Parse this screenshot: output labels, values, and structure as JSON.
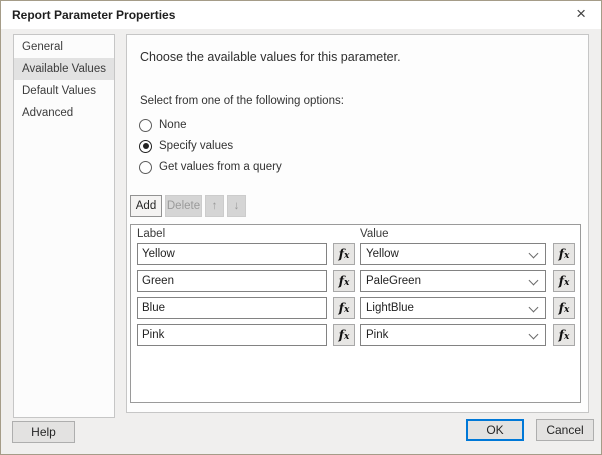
{
  "window": {
    "title": "Report Parameter Properties"
  },
  "icons": {
    "close": "×",
    "arrow_up": "↑",
    "arrow_down": "↓",
    "fx_f": "f",
    "fx_x": "x"
  },
  "sidebar": {
    "items": [
      {
        "label": "General",
        "selected": false
      },
      {
        "label": "Available Values",
        "selected": true
      },
      {
        "label": "Default Values",
        "selected": false
      },
      {
        "label": "Advanced",
        "selected": false
      }
    ]
  },
  "main": {
    "heading": "Choose the available values for this parameter.",
    "options_label": "Select from one of the following options:",
    "radio_options": [
      {
        "label": "None",
        "selected": false
      },
      {
        "label": "Specify values",
        "selected": true
      },
      {
        "label": "Get values from a query",
        "selected": false
      }
    ],
    "toolbar": {
      "add_label": "Add",
      "delete_label": "Delete"
    },
    "table": {
      "label_header": "Label",
      "value_header": "Value",
      "rows": [
        {
          "label": "Yellow",
          "value": "Yellow"
        },
        {
          "label": "Green",
          "value": "PaleGreen"
        },
        {
          "label": "Blue",
          "value": "LightBlue"
        },
        {
          "label": "Pink",
          "value": "Pink"
        }
      ]
    }
  },
  "footer": {
    "help_label": "Help",
    "ok_label": "OK",
    "cancel_label": "Cancel"
  },
  "colors": {
    "accent": "#0078d7",
    "dialog_border": "#a59c88",
    "panel_border": "#c6c6c6",
    "sidebar_selected_bg": "#e2e2e2"
  }
}
